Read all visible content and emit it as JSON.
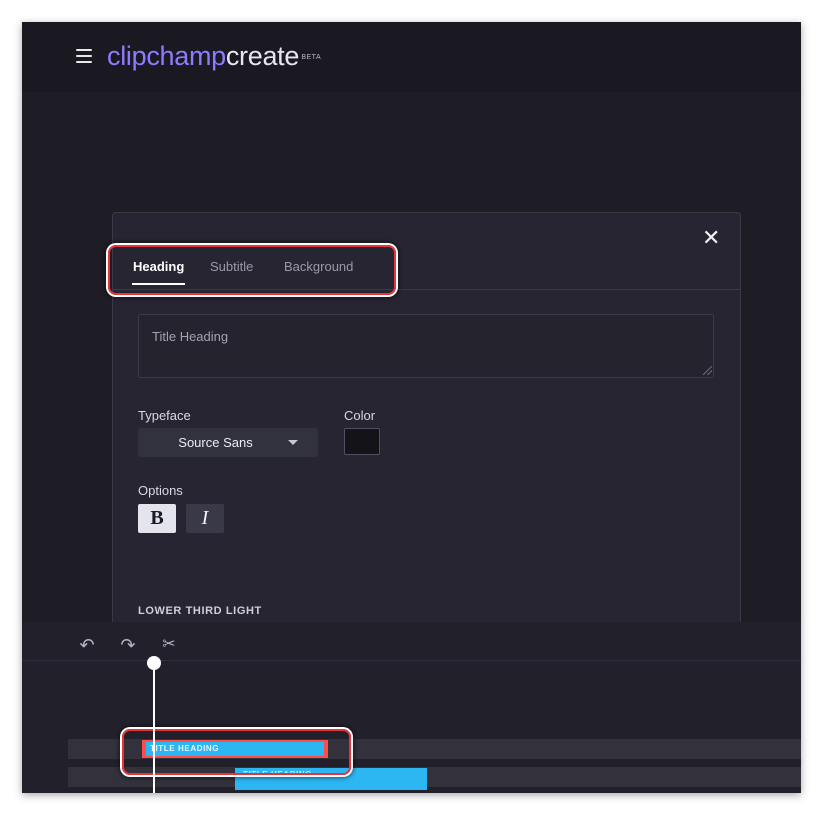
{
  "app": {
    "logo_part1": "clipchamp",
    "logo_part2": "create",
    "badge": "BETA"
  },
  "modal": {
    "tabs": [
      {
        "label": "Heading",
        "active": true
      },
      {
        "label": "Subtitle",
        "active": false
      },
      {
        "label": "Background",
        "active": false
      }
    ],
    "heading_input": {
      "value": "",
      "placeholder": "Title Heading"
    },
    "typeface": {
      "label": "Typeface",
      "value": "Source Sans"
    },
    "color": {
      "label": "Color",
      "value": "#141418"
    },
    "options": {
      "label": "Options",
      "bold_label": "B",
      "italic_label": "I",
      "bold_active": true
    },
    "template_name": "LOWER THIRD LIGHT"
  },
  "timeline": {
    "clips": [
      {
        "label": "TITLE HEADING"
      },
      {
        "label": "TITLE HEADING"
      }
    ]
  },
  "colors": {
    "accent": "#8d7bff",
    "clip": "#2cb6f2",
    "highlight": "#e3353a"
  }
}
